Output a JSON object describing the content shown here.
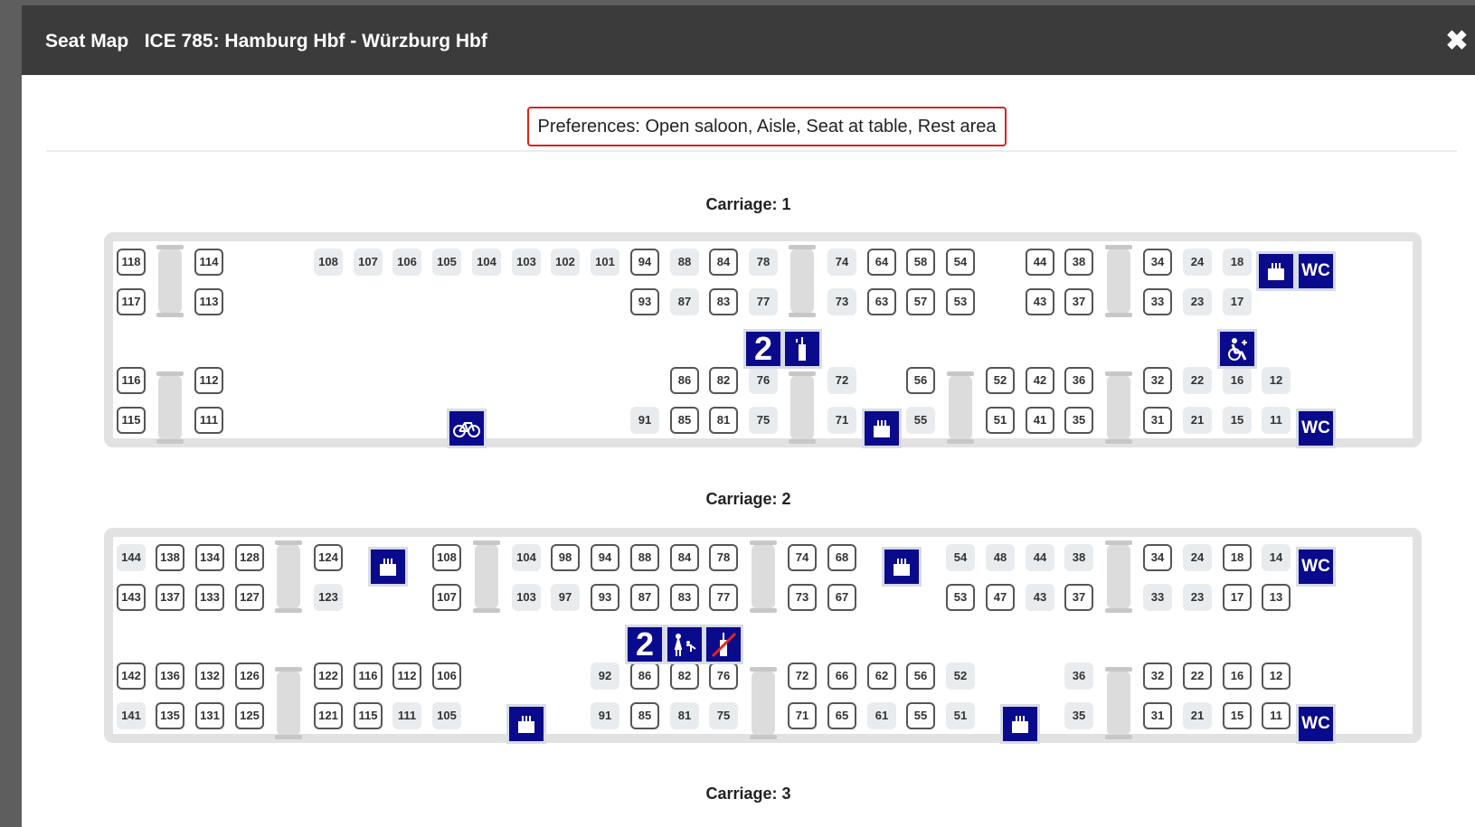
{
  "dialog": {
    "title_label": "Seat Map",
    "train": "ICE 785: Hamburg Hbf - Würzburg Hbf",
    "close_symbol": "✖"
  },
  "preferences": {
    "text": "Preferences: Open saloon, Aisle, Seat at table, Rest area"
  },
  "carriages": [
    {
      "label": "Carriage: 1"
    },
    {
      "label": "Carriage: 2"
    },
    {
      "label": "Carriage: 3"
    }
  ],
  "car1": {
    "row1": [
      "118",
      "114",
      "108",
      "107",
      "106",
      "105",
      "104",
      "103",
      "102",
      "101",
      "94",
      "88",
      "84",
      "78",
      "74",
      "64",
      "58",
      "54",
      "44",
      "38",
      "34",
      "24",
      "18"
    ],
    "row2": [
      "117",
      "113",
      "93",
      "87",
      "83",
      "77",
      "73",
      "63",
      "57",
      "53",
      "43",
      "37",
      "33",
      "23",
      "17"
    ],
    "row3": [
      "116",
      "112",
      "86",
      "82",
      "76",
      "72",
      "56",
      "52",
      "42",
      "36",
      "32",
      "22",
      "16",
      "12"
    ],
    "row4": [
      "115",
      "111",
      "91",
      "85",
      "81",
      "75",
      "71",
      "55",
      "51",
      "41",
      "35",
      "31",
      "21",
      "15",
      "11"
    ],
    "icons": {
      "wc": "WC",
      "class": "2"
    }
  },
  "car2": {
    "row1": [
      "144",
      "138",
      "134",
      "128",
      "124",
      "108",
      "104",
      "98",
      "94",
      "88",
      "84",
      "78",
      "74",
      "68",
      "54",
      "48",
      "44",
      "38",
      "34",
      "24",
      "18",
      "14"
    ],
    "row2": [
      "143",
      "137",
      "133",
      "127",
      "123",
      "107",
      "103",
      "97",
      "93",
      "87",
      "83",
      "77",
      "73",
      "67",
      "53",
      "47",
      "43",
      "37",
      "33",
      "23",
      "17",
      "13"
    ],
    "row3": [
      "142",
      "136",
      "132",
      "126",
      "122",
      "116",
      "112",
      "106",
      "92",
      "86",
      "82",
      "76",
      "72",
      "66",
      "62",
      "56",
      "52",
      "36",
      "32",
      "22",
      "16",
      "12"
    ],
    "row4": [
      "141",
      "135",
      "131",
      "125",
      "121",
      "115",
      "111",
      "105",
      "91",
      "85",
      "81",
      "75",
      "71",
      "65",
      "61",
      "55",
      "51",
      "35",
      "31",
      "21",
      "15",
      "11"
    ],
    "icons": {
      "wc": "WC",
      "class": "2"
    }
  },
  "theme": {
    "header_bg": "#3b3b3b",
    "icon_blue": "#0a0a8c",
    "highlight_red": "#dd2222",
    "seat_gray": "#e9ecee"
  }
}
